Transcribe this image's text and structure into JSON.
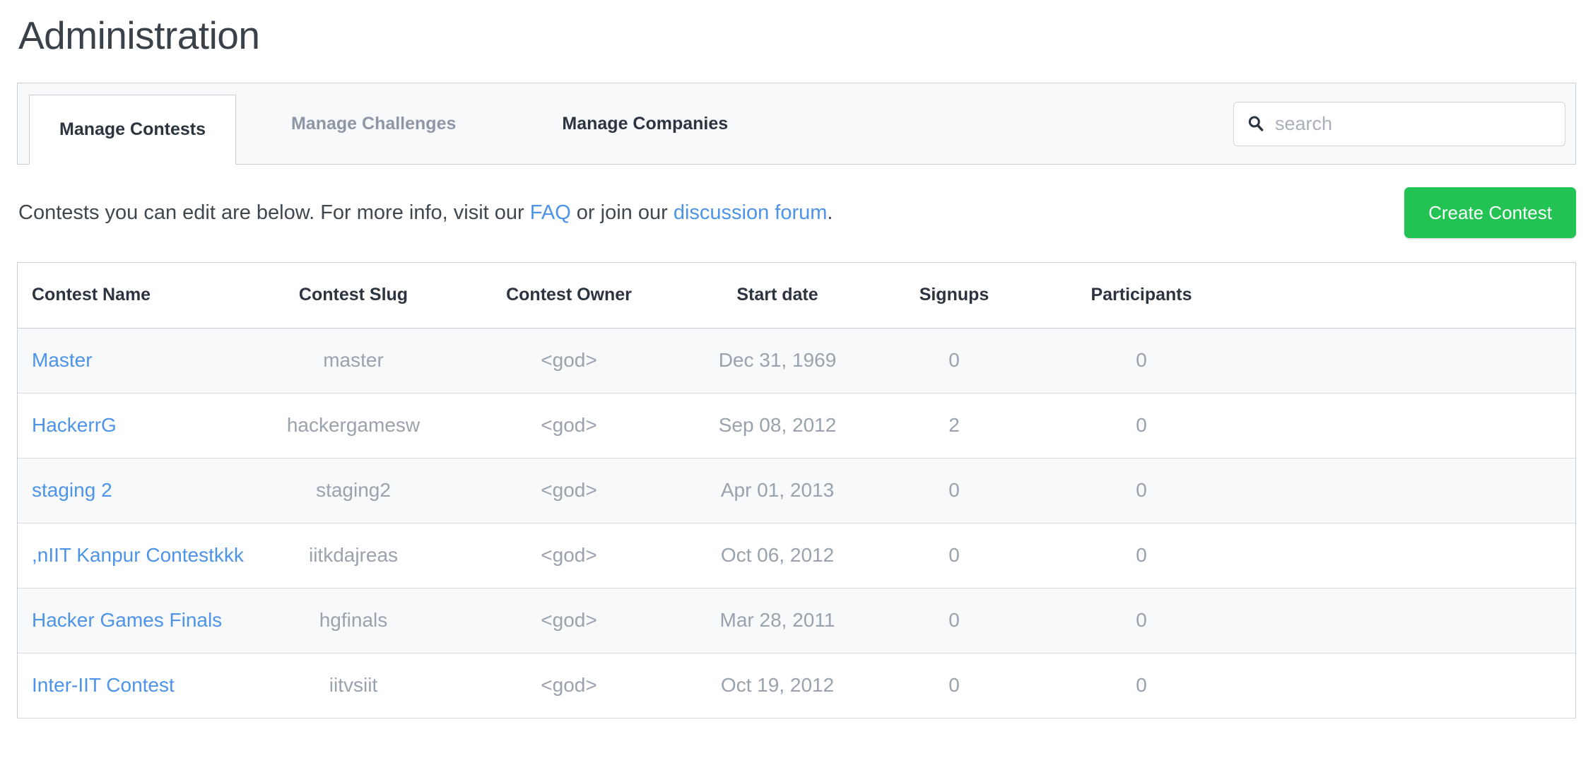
{
  "page_title": "Administration",
  "tabs": [
    {
      "label": "Manage Contests",
      "state": "active"
    },
    {
      "label": "Manage Challenges",
      "state": "muted"
    },
    {
      "label": "Manage Companies",
      "state": "normal"
    }
  ],
  "search": {
    "value": "",
    "placeholder": "search",
    "icon": "search-icon"
  },
  "description": {
    "part1": "Contests you can edit are below. For more info, visit our ",
    "link_faq": "FAQ",
    "part2": " or join our ",
    "link_forum": "discussion forum",
    "part3": "."
  },
  "create_button": {
    "label": "Create Contest",
    "color": "#22c353"
  },
  "colors": {
    "link": "#4d93e8",
    "accent_green": "#22c353",
    "header_text": "#2c3440",
    "muted_text": "#9aa2ad",
    "row_alt_bg": "#f8f9fb",
    "border": "#c9cfd8"
  },
  "table": {
    "headers": [
      "Contest Name",
      "Contest Slug",
      "Contest Owner",
      "Start date",
      "Signups",
      "Participants"
    ],
    "rows": [
      {
        "name": "Master",
        "slug": "master",
        "owner": "<god>",
        "start_date": "Dec 31, 1969",
        "signups": "0",
        "participants": "0"
      },
      {
        "name": "HackerrG",
        "slug": "hackergamesw",
        "owner": "<god>",
        "start_date": "Sep 08, 2012",
        "signups": "2",
        "participants": "0"
      },
      {
        "name": "staging 2",
        "slug": "staging2",
        "owner": "<god>",
        "start_date": "Apr 01, 2013",
        "signups": "0",
        "participants": "0"
      },
      {
        "name": ",nIIT Kanpur Contestkkk",
        "slug": "iitkdajreas",
        "owner": "<god>",
        "start_date": "Oct 06, 2012",
        "signups": "0",
        "participants": "0"
      },
      {
        "name": "Hacker Games Finals",
        "slug": "hgfinals",
        "owner": "<god>",
        "start_date": "Mar 28, 2011",
        "signups": "0",
        "participants": "0"
      },
      {
        "name": "Inter-IIT Contest",
        "slug": "iitvsiit",
        "owner": "<god>",
        "start_date": "Oct 19, 2012",
        "signups": "0",
        "participants": "0"
      }
    ]
  }
}
